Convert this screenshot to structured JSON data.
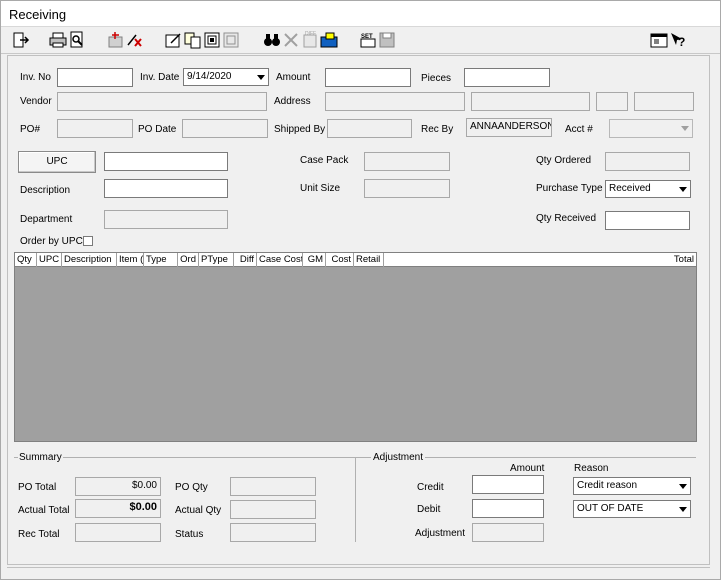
{
  "window": {
    "title": "Receiving"
  },
  "toolbar": {
    "icons": [
      "exit-icon",
      "print-icon",
      "print-preview-icon",
      "add-item-icon",
      "clear-icon",
      "edit-form-icon",
      "copy-docs-icon",
      "calc-icon",
      "report-icon",
      "find-binoculars-icon",
      "delete-icon",
      "diff-icon",
      "post-icon",
      "set-icon",
      "save-disk-icon",
      "properties-icon",
      "help-icon"
    ]
  },
  "header": {
    "inv_no_label": "Inv. No",
    "inv_no_value": "",
    "inv_date_label": "Inv. Date",
    "inv_date_value": "9/14/2020",
    "amount_label": "Amount",
    "amount_value": "",
    "pieces_label": "Pieces",
    "pieces_value": "",
    "vendor_label": "Vendor",
    "address_label": "Address",
    "po_label": "PO#",
    "po_date_label": "PO Date",
    "shipped_by_label": "Shipped By",
    "rec_by_label": "Rec By",
    "rec_by_value": "ANNAANDERSON",
    "acct_label": "Acct #"
  },
  "item": {
    "upc_button": "UPC",
    "upc_value": "",
    "case_pack_label": "Case Pack",
    "qty_ordered_label": "Qty Ordered",
    "description_label": "Description",
    "unit_size_label": "Unit   Size",
    "purchase_type_label": "Purchase Type",
    "purchase_type_value": "Received",
    "department_label": "Department",
    "qty_received_label": "Qty Received",
    "order_by_upc_label": "Order by UPC"
  },
  "grid": {
    "columns": [
      "Qty",
      "UPC",
      "Description",
      "Item (",
      "Type",
      "Ord",
      "PType",
      "Diff",
      "Case Cost",
      "GM",
      "Cost",
      "Retail",
      "Total"
    ]
  },
  "summary": {
    "title": "Summary",
    "po_total_label": "PO Total",
    "po_total_value": "$0.00",
    "actual_total_label": "Actual Total",
    "actual_total_value": "$0.00",
    "rec_total_label": "Rec Total",
    "po_qty_label": "PO Qty",
    "actual_qty_label": "Actual Qty",
    "status_label": "Status"
  },
  "adjustment": {
    "title": "Adjustment",
    "amount_header": "Amount",
    "reason_header": "Reason",
    "credit_label": "Credit",
    "credit_reason": "Credit reason",
    "debit_label": "Debit",
    "debit_reason": "OUT OF DATE",
    "adjustment_label": "Adjustment"
  }
}
